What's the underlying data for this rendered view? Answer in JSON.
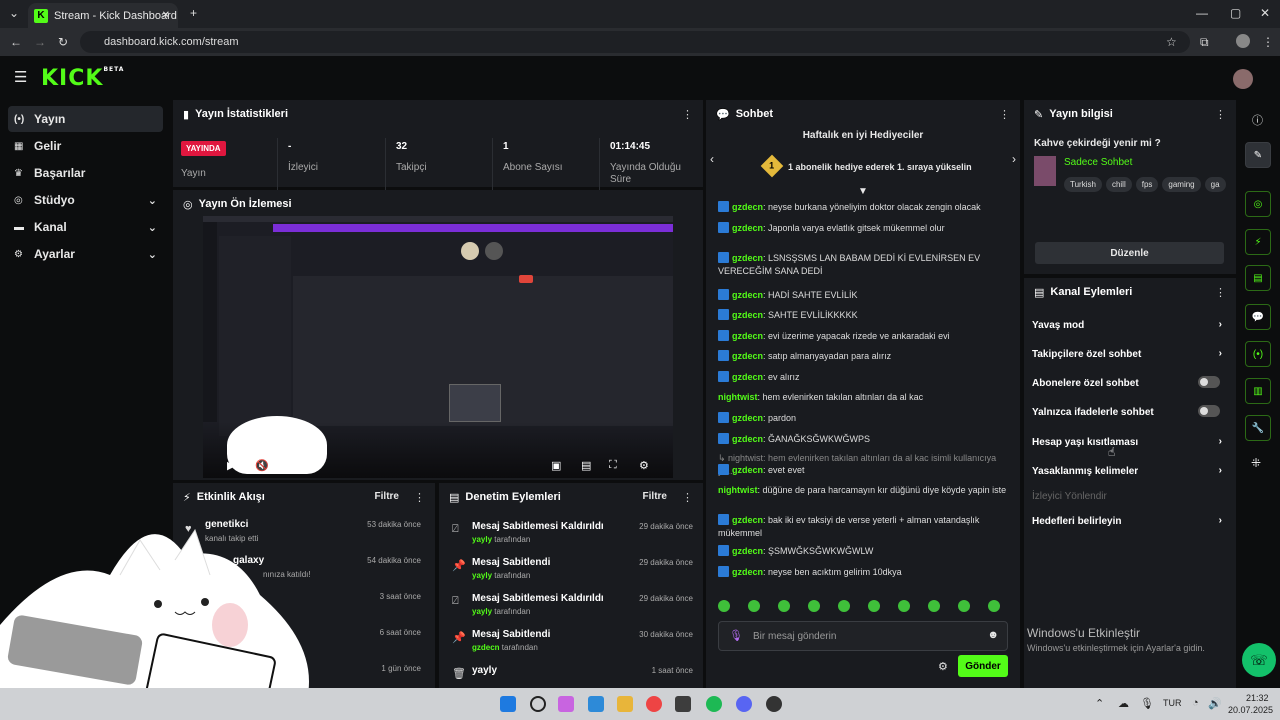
{
  "browser": {
    "tab_title": "Stream - Kick Dashboard",
    "url": "dashboard.kick.com/stream"
  },
  "header": {
    "logo": "KICK",
    "logo_sup": "BETA"
  },
  "sidebar": {
    "items": [
      {
        "label": "Yayın"
      },
      {
        "label": "Gelir"
      },
      {
        "label": "Başarılar"
      },
      {
        "label": "Stüdyo"
      },
      {
        "label": "Kanal"
      },
      {
        "label": "Ayarlar"
      }
    ]
  },
  "stats": {
    "title": "Yayın İstatistikleri",
    "live_badge": "YAYINDA",
    "live_label": "Yayın",
    "items": [
      {
        "value": "-",
        "label": "İzleyici"
      },
      {
        "value": "32",
        "label": "Takipçi"
      },
      {
        "value": "1",
        "label": "Abone Sayısı"
      },
      {
        "value": "01:14:45",
        "label": "Yayında Olduğu Süre"
      }
    ]
  },
  "preview": {
    "title": "Yayın Ön İzlemesi"
  },
  "activity": {
    "title": "Etkinlik Akışı",
    "filter": "Filtre",
    "rows": [
      {
        "name": "genetikci",
        "sub": "kanalı takip etti",
        "time": "53 dakika önce"
      },
      {
        "name": "galaxy",
        "sub": "nınıza katıldı!",
        "time": "54 dakika önce"
      },
      {
        "name": "",
        "sub": "",
        "time": "3 saat önce"
      },
      {
        "name": "",
        "sub": "",
        "time": "6 saat önce"
      },
      {
        "name": "",
        "sub": "",
        "time": "1 gün önce"
      }
    ]
  },
  "moderation": {
    "title": "Denetim Eylemleri",
    "filter": "Filtre",
    "by": "tarafından",
    "rows": [
      {
        "action": "Mesaj Sabitlemesi Kaldırıldı",
        "user": "yayly",
        "time": "29 dakika önce"
      },
      {
        "action": "Mesaj Sabitlendi",
        "user": "yayly",
        "time": "29 dakika önce"
      },
      {
        "action": "Mesaj Sabitlemesi Kaldırıldı",
        "user": "yayly",
        "time": "29 dakika önce"
      },
      {
        "action": "Mesaj Sabitlendi",
        "user": "gzdecn",
        "time": "30 dakika önce"
      },
      {
        "action": "yayly",
        "user": "",
        "time": "1 saat önce"
      }
    ]
  },
  "chat": {
    "title": "Sohbet",
    "gifters_title": "Haftalık en iyi Hediyeciler",
    "gifters_rank": "1",
    "gifters_text": "1 abonelik hediye ederek 1. sıraya yükselin",
    "messages": [
      {
        "user": "gzdecn",
        "text": "neyse burkana yöneliyim doktor olacak zengin olacak"
      },
      {
        "user": "gzdecn",
        "text": "Japonla varya evlatlık gitsek mükemmel olur"
      },
      {
        "user": "gzdecn",
        "text": "LSNSŞSMS LAN BABAM DEDİ Kİ EVLENİRSEN EV VERECEĞİM SANA DEDİ"
      },
      {
        "user": "gzdecn",
        "text": "HADİ SAHTE EVLİLİK"
      },
      {
        "user": "gzdecn",
        "text": "SAHTE EVLİLİKKKKK"
      },
      {
        "user": "gzdecn",
        "text": "evi üzerime yapacak rizede ve ankaradaki evi"
      },
      {
        "user": "gzdecn",
        "text": "satıp almanyayadan para alırız"
      },
      {
        "user": "gzdecn",
        "text": "ev alırız"
      },
      {
        "user": "nightwist",
        "text": "hem evlenirken takılan altınları da al kac"
      },
      {
        "user": "gzdecn",
        "text": "pardon"
      },
      {
        "user": "gzdecn",
        "text": "ĞANAĞKSĞWKWĞWPS"
      },
      {
        "user": "",
        "text": "↳ nightwist: hem evlenirken takılan altınları da al kac isimli kullanıcıya ya..."
      },
      {
        "user": "gzdecn",
        "text": "evet evet"
      },
      {
        "user": "nightwist",
        "text": "düğüne de para harcamayın kır düğünü diye köyde yapin iste"
      },
      {
        "user": "gzdecn",
        "text": "bak iki ev taksiyi de verse yeterli + alman vatandaşlık mükemmel"
      },
      {
        "user": "gzdecn",
        "text": "ŞSMWĞKSĞWKWĞWLW"
      },
      {
        "user": "gzdecn",
        "text": "neyse ben acıktım gelirim 10dkya"
      }
    ],
    "input_placeholder": "Bir mesaj gönderin",
    "send": "Gönder"
  },
  "stream_info": {
    "title": "Yayın bilgisi",
    "stream_title": "Kahve çekirdeği yenir mi ?",
    "category": "Sadece Sohbet",
    "tags": [
      "Turkish",
      "chill",
      "fps",
      "gaming",
      "ga"
    ],
    "edit": "Düzenle"
  },
  "channel_actions": {
    "title": "Kanal Eylemleri",
    "items": [
      {
        "label": "Yavaş mod",
        "kind": "arrow"
      },
      {
        "label": "Takipçilere özel sohbet",
        "kind": "arrow"
      },
      {
        "label": "Abonelere özel sohbet",
        "kind": "toggle"
      },
      {
        "label": "Yalnızca ifadelerle sohbet",
        "kind": "toggle"
      },
      {
        "label": "Hesap yaşı kısıtlaması",
        "kind": "arrow"
      },
      {
        "label": "Yasaklanmış kelimeler",
        "kind": "arrow"
      },
      {
        "label": "İzleyici Yönlendir",
        "kind": "disabled"
      },
      {
        "label": "Hedefleri belirleyin",
        "kind": "arrow"
      }
    ]
  },
  "watermark": {
    "line1": "Windows'u Etkinleştir",
    "line2": "Windows'u etkinleştirmek için Ayarlar'a gidin."
  },
  "taskbar": {
    "lang": "TUR",
    "time": "21:32",
    "date": "20.07.2025"
  },
  "colors": {
    "accent": "#53fc18",
    "live": "#e0173f"
  }
}
